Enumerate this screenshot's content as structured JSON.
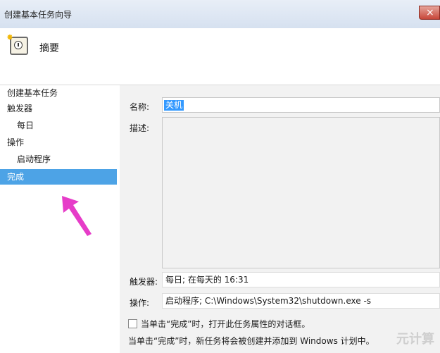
{
  "window": {
    "title": "创建基本任务向导"
  },
  "header": {
    "title": "摘要"
  },
  "sidebar": {
    "items": [
      {
        "label": "创建基本任务",
        "level": 0,
        "selected": false
      },
      {
        "label": "触发器",
        "level": 0,
        "selected": false
      },
      {
        "label": "每日",
        "level": 1,
        "selected": false
      },
      {
        "label": "操作",
        "level": 0,
        "selected": false
      },
      {
        "label": "启动程序",
        "level": 1,
        "selected": false
      },
      {
        "label": "完成",
        "level": 0,
        "selected": true
      }
    ]
  },
  "main": {
    "name_label": "名称:",
    "name_value": "关机",
    "desc_label": "描述:",
    "trigger_label": "触发器:",
    "trigger_value": "每日; 在每天的 16:31",
    "action_label": "操作:",
    "action_value": "启动程序; C:\\Windows\\System32\\shutdown.exe -s",
    "checkbox_label": "当单击“完成”时，打开此任务属性的对话框。",
    "checkbox_checked": false,
    "note": "当单击“完成”时，新任务将会被创建并添加到 Windows 计划中。"
  },
  "watermark": "元计算",
  "colors": {
    "selected": "#4da3e6",
    "arrow": "#e63cc8"
  }
}
